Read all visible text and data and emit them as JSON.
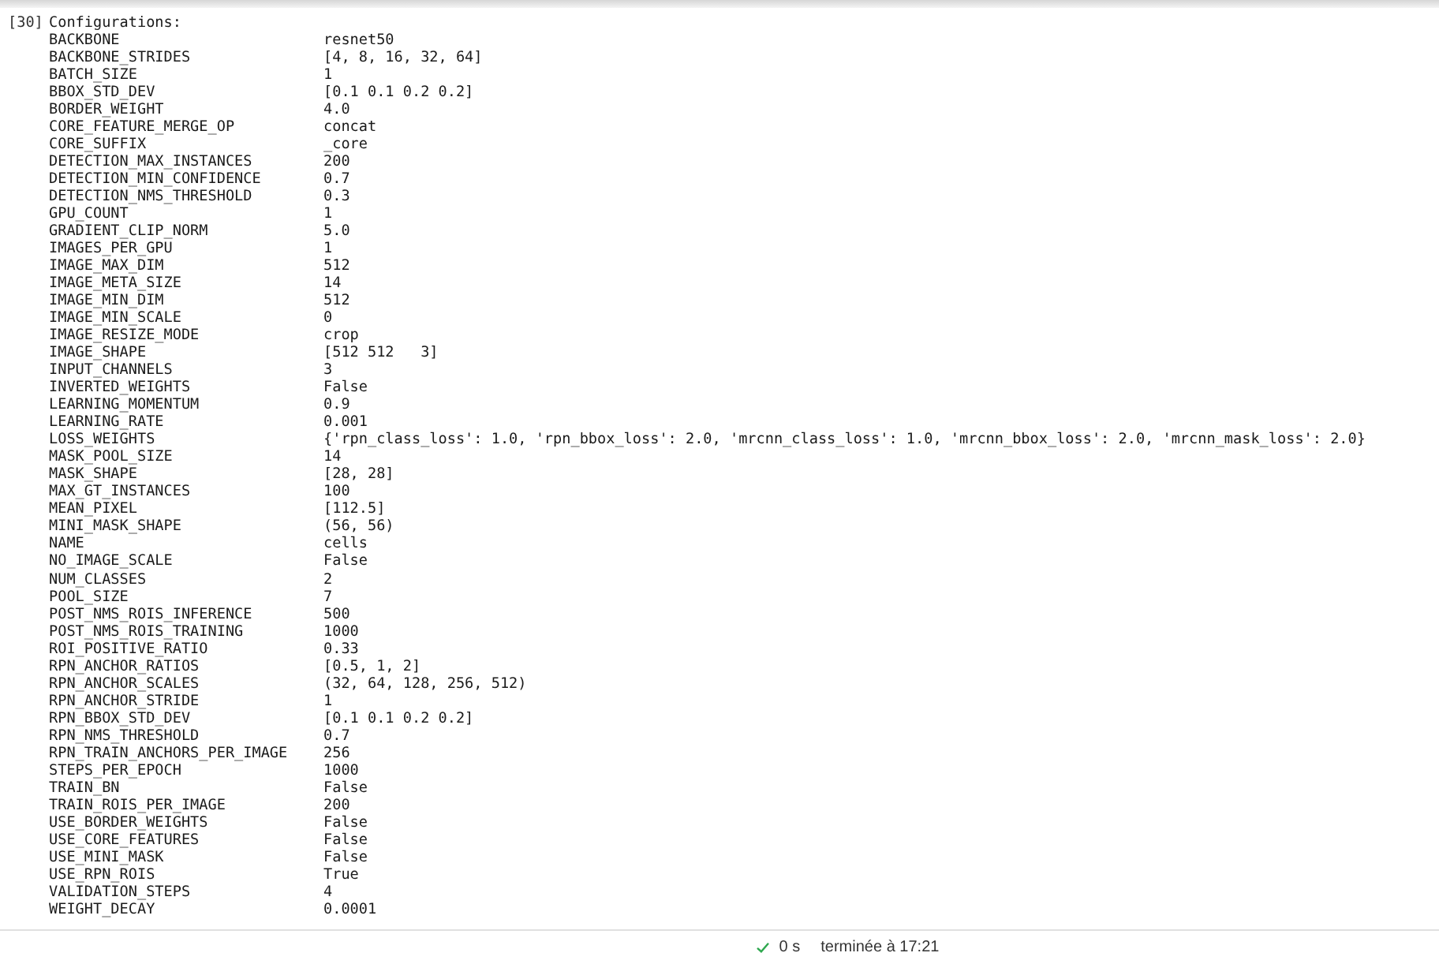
{
  "output_cell": {
    "prompt": "[30]",
    "heading": "Configurations:",
    "entries": [
      {
        "key": "BACKBONE",
        "value": "resnet50"
      },
      {
        "key": "BACKBONE_STRIDES",
        "value": "[4, 8, 16, 32, 64]"
      },
      {
        "key": "BATCH_SIZE",
        "value": "1"
      },
      {
        "key": "BBOX_STD_DEV",
        "value": "[0.1 0.1 0.2 0.2]"
      },
      {
        "key": "BORDER_WEIGHT",
        "value": "4.0"
      },
      {
        "key": "CORE_FEATURE_MERGE_OP",
        "value": "concat"
      },
      {
        "key": "CORE_SUFFIX",
        "value": "_core"
      },
      {
        "key": "DETECTION_MAX_INSTANCES",
        "value": "200"
      },
      {
        "key": "DETECTION_MIN_CONFIDENCE",
        "value": "0.7"
      },
      {
        "key": "DETECTION_NMS_THRESHOLD",
        "value": "0.3"
      },
      {
        "key": "GPU_COUNT",
        "value": "1"
      },
      {
        "key": "GRADIENT_CLIP_NORM",
        "value": "5.0"
      },
      {
        "key": "IMAGES_PER_GPU",
        "value": "1"
      },
      {
        "key": "IMAGE_MAX_DIM",
        "value": "512"
      },
      {
        "key": "IMAGE_META_SIZE",
        "value": "14"
      },
      {
        "key": "IMAGE_MIN_DIM",
        "value": "512"
      },
      {
        "key": "IMAGE_MIN_SCALE",
        "value": "0"
      },
      {
        "key": "IMAGE_RESIZE_MODE",
        "value": "crop"
      },
      {
        "key": "IMAGE_SHAPE",
        "value": "[512 512   3]"
      },
      {
        "key": "INPUT_CHANNELS",
        "value": "3"
      },
      {
        "key": "INVERTED_WEIGHTS",
        "value": "False"
      },
      {
        "key": "LEARNING_MOMENTUM",
        "value": "0.9"
      },
      {
        "key": "LEARNING_RATE",
        "value": "0.001"
      },
      {
        "key": "LOSS_WEIGHTS",
        "value": "{'rpn_class_loss': 1.0, 'rpn_bbox_loss': 2.0, 'mrcnn_class_loss': 1.0, 'mrcnn_bbox_loss': 2.0, 'mrcnn_mask_loss': 2.0}"
      },
      {
        "key": "MASK_POOL_SIZE",
        "value": "14"
      },
      {
        "key": "MASK_SHAPE",
        "value": "[28, 28]"
      },
      {
        "key": "MAX_GT_INSTANCES",
        "value": "100"
      },
      {
        "key": "MEAN_PIXEL",
        "value": "[112.5]"
      },
      {
        "key": "MINI_MASK_SHAPE",
        "value": "(56, 56)"
      },
      {
        "key": "NAME",
        "value": "cells"
      },
      {
        "key": "NO_IMAGE_SCALE",
        "value": "False"
      },
      {
        "key": "NUM_CLASSES",
        "value": "2"
      },
      {
        "key": "POOL_SIZE",
        "value": "7"
      },
      {
        "key": "POST_NMS_ROIS_INFERENCE",
        "value": "500"
      },
      {
        "key": "POST_NMS_ROIS_TRAINING",
        "value": "1000"
      },
      {
        "key": "ROI_POSITIVE_RATIO",
        "value": "0.33"
      },
      {
        "key": "RPN_ANCHOR_RATIOS",
        "value": "[0.5, 1, 2]"
      },
      {
        "key": "RPN_ANCHOR_SCALES",
        "value": "(32, 64, 128, 256, 512)"
      },
      {
        "key": "RPN_ANCHOR_STRIDE",
        "value": "1"
      },
      {
        "key": "RPN_BBOX_STD_DEV",
        "value": "[0.1 0.1 0.2 0.2]"
      },
      {
        "key": "RPN_NMS_THRESHOLD",
        "value": "0.7"
      },
      {
        "key": "RPN_TRAIN_ANCHORS_PER_IMAGE",
        "value": "256"
      },
      {
        "key": "STEPS_PER_EPOCH",
        "value": "1000"
      },
      {
        "key": "TRAIN_BN",
        "value": "False"
      },
      {
        "key": "TRAIN_ROIS_PER_IMAGE",
        "value": "200"
      },
      {
        "key": "USE_BORDER_WEIGHTS",
        "value": "False"
      },
      {
        "key": "USE_CORE_FEATURES",
        "value": "False"
      },
      {
        "key": "USE_MINI_MASK",
        "value": "False"
      },
      {
        "key": "USE_RPN_ROIS",
        "value": "True"
      },
      {
        "key": "VALIDATION_STEPS",
        "value": "4"
      },
      {
        "key": "WEIGHT_DECAY",
        "value": "0.0001"
      }
    ]
  },
  "status_bar": {
    "duration": "0 s",
    "finished": "terminée à 17:21"
  }
}
